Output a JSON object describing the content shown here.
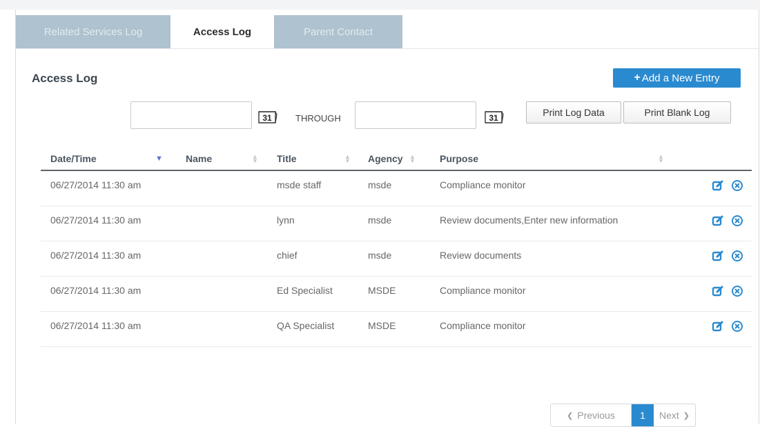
{
  "tabs": [
    {
      "label": "Related Services Log",
      "active": false
    },
    {
      "label": "Access Log",
      "active": true
    },
    {
      "label": "Parent Contact",
      "active": false
    }
  ],
  "heading": "Access Log",
  "add_button": {
    "icon": "plus-icon",
    "label": "Add a New Entry"
  },
  "filters": {
    "start_value": "",
    "end_value": "",
    "calendar_day": "31",
    "through_label": "THROUGH"
  },
  "print_buttons": {
    "data": "Print Log Data",
    "blank": "Print Blank Log"
  },
  "table": {
    "columns": [
      "Date/Time",
      "Name",
      "Title",
      "Agency",
      "Purpose"
    ],
    "sorted_column": "Date/Time",
    "rows": [
      {
        "datetime": "06/27/2014 11:30 am",
        "name": "",
        "title": "msde staff",
        "agency": "msde",
        "purpose": "Compliance monitor"
      },
      {
        "datetime": "06/27/2014 11:30 am",
        "name": "",
        "title": "lynn",
        "agency": "msde",
        "purpose": "Review documents,Enter new information"
      },
      {
        "datetime": "06/27/2014 11:30 am",
        "name": "",
        "title": "chief",
        "agency": "msde",
        "purpose": "Review documents"
      },
      {
        "datetime": "06/27/2014 11:30 am",
        "name": "",
        "title": "Ed Specialist",
        "agency": "MSDE",
        "purpose": "Compliance monitor"
      },
      {
        "datetime": "06/27/2014 11:30 am",
        "name": "",
        "title": "QA Specialist",
        "agency": "MSDE",
        "purpose": "Compliance monitor"
      }
    ],
    "row_actions": [
      "edit-icon",
      "delete-icon"
    ]
  },
  "pagination": {
    "previous": "Previous",
    "current": "1",
    "next": "Next"
  },
  "colors": {
    "accent": "#2a8ad0",
    "tab_inactive": "#aec2cf",
    "sort_arrow": "#5a6fd6"
  }
}
